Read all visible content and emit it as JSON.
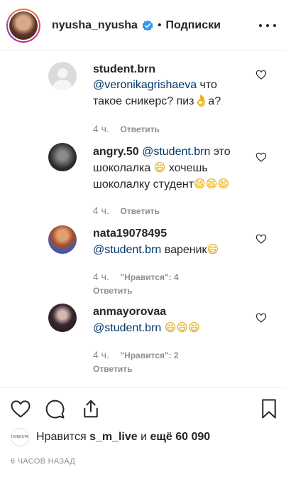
{
  "header": {
    "username": "nyusha_nyusha",
    "separator": "•",
    "follow_status": "Подписки"
  },
  "comments": [
    {
      "username": "student.brn",
      "mention": "@veronikagrishaeva",
      "text": "что такое сникерс? пиз",
      "emoji": "👌",
      "text_after": "а?",
      "time": "4 ч.",
      "likes": "",
      "reply": "Ответить"
    },
    {
      "username": "angry.50",
      "mention": "@student.brn",
      "text": "это шоколалка",
      "emoji": "😄",
      "text_after": "хочешь шоколалку студент",
      "emoji_tail": "😄😄😄",
      "time": "4 ч.",
      "likes": "",
      "reply": "Ответить"
    },
    {
      "username": "nata19078495",
      "mention": "@student.brn",
      "text": "вареник",
      "emoji": "😄",
      "time": "4 ч.",
      "likes": "\"Нравится\": 4",
      "reply": "Ответить"
    },
    {
      "username": "anmayorovaa",
      "mention": "@student.brn",
      "text": "",
      "emoji": "😄😄😄",
      "time": "4 ч.",
      "likes": "\"Нравится\": 2",
      "reply": "Ответить"
    }
  ],
  "footer": {
    "likes_prefix": "Нравится",
    "liked_by": "s_m_live",
    "likes_and": "и",
    "likes_more": "ещё 60 090",
    "likes_avatar_text": "HONESTA",
    "timestamp": "6 ЧАСОВ НАЗАД"
  },
  "icons": {
    "verified": "verified-badge-icon",
    "more": "more-options-icon",
    "like": "heart-icon",
    "comment": "comment-icon",
    "share": "share-icon",
    "save": "bookmark-icon"
  },
  "colors": {
    "mention": "#00376b",
    "verified": "#3897f0",
    "secondary": "#8e8e8e"
  }
}
